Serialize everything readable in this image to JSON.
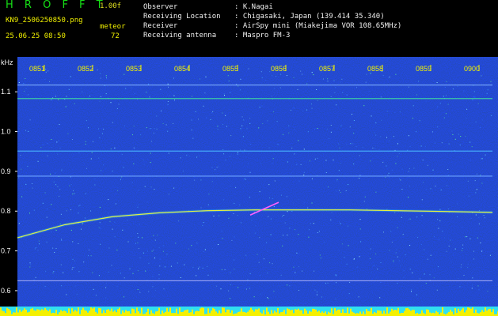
{
  "header": {
    "brand": "H R O F F T",
    "version": "1.00f",
    "filename": "KN9_2506250850.png",
    "meteor_label": "meteor",
    "datetime": "25.06.25 08:50",
    "meteor_count": "72",
    "info": [
      {
        "label": "Observer",
        "value": ": K.Nagai"
      },
      {
        "label": "Receiving Location",
        "value": ": Chigasaki, Japan (139.414 35.340)"
      },
      {
        "label": "Receiver",
        "value": ": AirSpy mini (Miakejima VOR 108.65MHz)"
      },
      {
        "label": "Receiving antenna",
        "value": ": Maspro FM-3"
      }
    ]
  },
  "colors": {
    "background": "#000000",
    "spectrum_base": "#0a1a8c",
    "text_yellow": "#f0f000",
    "brand_green": "#16e016",
    "signal_cyan": "#40e0e0",
    "signal_yellow": "#e8f040"
  },
  "chart_data": {
    "type": "heatmap",
    "ylabel": "kHz",
    "x_ticks": [
      "0851",
      "0852",
      "0853",
      "0854",
      "0855",
      "0856",
      "0857",
      "0858",
      "0859",
      "0900"
    ],
    "y_ticks": [
      "1.1",
      "1.0",
      "0.9",
      "0.8",
      "0.7",
      "0.6"
    ],
    "ylim": [
      0.58,
      1.16
    ],
    "xlim_minutes": [
      0,
      10
    ],
    "constant_lines_khz": [
      1.117,
      1.083,
      0.951,
      0.888,
      0.625
    ],
    "main_signal": {
      "x_minutes": [
        0.0,
        1.0,
        2.0,
        3.0,
        4.0,
        5.0,
        6.0,
        7.0,
        8.0,
        9.0,
        10.0
      ],
      "khz": [
        0.733,
        0.766,
        0.786,
        0.796,
        0.801,
        0.803,
        0.803,
        0.803,
        0.801,
        0.799,
        0.797
      ]
    },
    "meteor_trail": {
      "x_minutes": [
        4.9,
        5.5
      ],
      "khz": [
        0.79,
        0.822
      ]
    }
  }
}
